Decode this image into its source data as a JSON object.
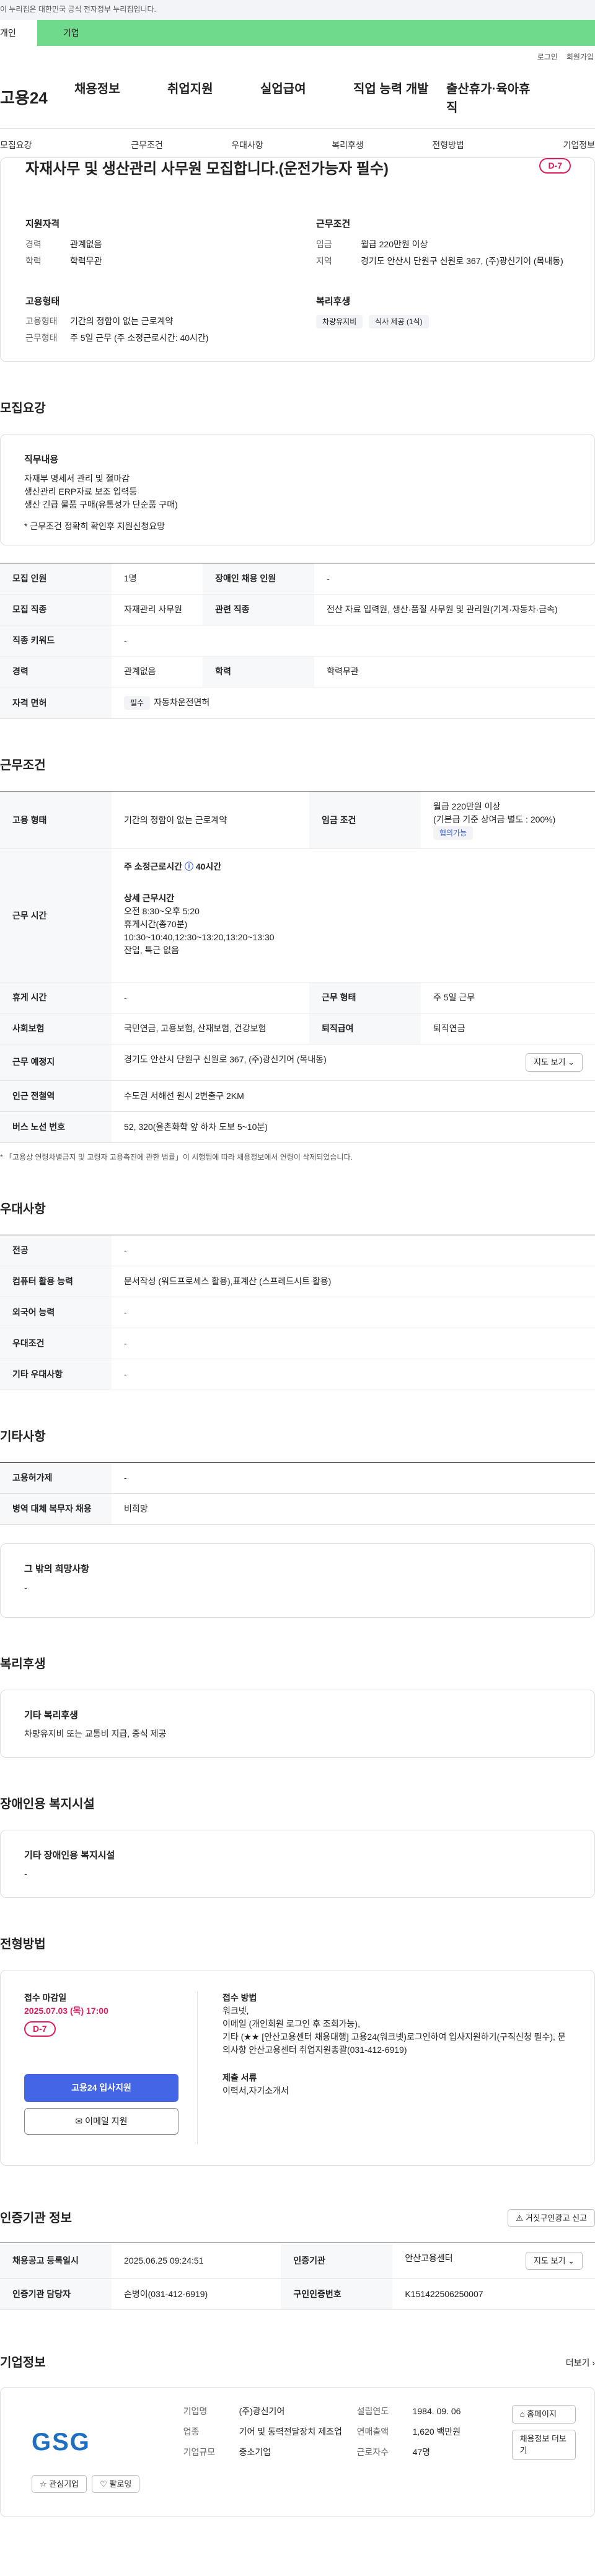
{
  "gov_banner": "이 누리집은 대한민국 공식 전자정부 누리집입니다.",
  "top_tabs": {
    "a": "개인",
    "b": "기업"
  },
  "util": {
    "login": "로그인",
    "join": "회원가입"
  },
  "gnb": {
    "logo": "고용24",
    "items": [
      "채용정보",
      "취업지원",
      "실업급여",
      "직업 능력 개발",
      "출산휴가·육아휴직"
    ]
  },
  "anchors": [
    "모집요강",
    "근무조건",
    "우대사항",
    "복리후생",
    "전형방법",
    "기업정보"
  ],
  "summary": {
    "title": "자재사무 및 생산관리 사무원 모집합니다.(운전가능자 필수)",
    "dday": "D-7",
    "groups": {
      "qual": {
        "title": "지원자격",
        "rows": [
          [
            "경력",
            "관계없음"
          ],
          [
            "학력",
            "학력무관"
          ]
        ]
      },
      "cond": {
        "title": "근무조건",
        "rows": [
          [
            "임금",
            "월급 220만원 이상"
          ],
          [
            "지역",
            "경기도 안산시 단원구 신원로 367, (주)광신기어 (목내동)"
          ]
        ]
      },
      "type": {
        "title": "고용형태",
        "rows": [
          [
            "고용형태",
            "기간의 정함이 없는 근로계약"
          ],
          [
            "근무형태",
            "주 5일 근무 (주 소정근로시간: 40시간)"
          ]
        ]
      },
      "welfare": {
        "title": "복리후생",
        "chips": [
          "차량유지비",
          "식사 제공 (1식)"
        ]
      }
    }
  },
  "recruit": {
    "title": "모집요강",
    "job_box_title": "직무내용",
    "job_lines": [
      "자재부 명세서 관리 및 절마감",
      "생산관리 ERP자료 보조 입력등",
      "생산 긴급 물품 구매(유통성가 단순품 구매)",
      "",
      "* 근무조건 정확히 확인후 지원신청요망"
    ],
    "rows": [
      {
        "k1": "모집 인원",
        "v1": "1명",
        "k2": "장애인 채용 인원",
        "v2": "-"
      },
      {
        "k1": "모집 직종",
        "v1": "자재관리 사무원",
        "k2": "관련 직종",
        "v2": "전산 자료 입력원, 생산·품질 사무원 및 관리원(기계·자동차·금속)"
      },
      {
        "k1": "직종 키워드",
        "v1": "-"
      },
      {
        "k1": "경력",
        "v1": "관계없음",
        "k2": "학력",
        "v2": "학력무관"
      },
      {
        "k1": "자격 면허",
        "badge": "필수",
        "v1": "자동차운전면허"
      }
    ]
  },
  "conditions": {
    "title": "근무조건",
    "type_k": "고용 형태",
    "type_v": "기간의 정함이 없는 근로계약",
    "wage_k": "임금 조건",
    "wage_lines": [
      "월급 220만원 이상",
      "(기본급 기준 상여금 별도 : 200%)"
    ],
    "wage_badge": "협의가능",
    "hours_k": "근무 시간",
    "hours_head": "주 소정근로시간",
    "hours_val": "40시간",
    "hours_lines": [
      "상세 근무시간",
      "오전 8:30~오후 5:20",
      "휴게시간(총70분)",
      "10:30~10:40,12:30~13:20,13:20~13:30",
      "잔업, 특근 없음"
    ],
    "rest_k": "휴게 시간",
    "rest_v": "-",
    "form_k": "근무 형태",
    "form_v": "주 5일 근무",
    "ins_k": "사회보험",
    "ins_v": "국민연금, 고용보험, 산재보험, 건강보험",
    "ret_k": "퇴직급여",
    "ret_v": "퇴직연금",
    "place_k": "근무 예정지",
    "place_v": "경기도 안산시 단원구 신원로 367, (주)광신기어 (목내동)",
    "map_btn": "지도 보기",
    "sub_k": "인근 전철역",
    "sub_v": "수도권 서해선 원시 2번출구 2KM",
    "bus_k": "버스 노선 번호",
    "bus_v": "52, 320(율촌화학 앞 하차 도보 5~10분)",
    "note": "* 「고용상 연령차별금지 및 고령자 고용촉진에 관한 법률」이 시행됨에 따라 채용정보에서 연령이 삭제되었습니다."
  },
  "pref": {
    "title": "우대사항",
    "rows": [
      [
        "전공",
        "-"
      ],
      [
        "컴퓨터 활용 능력",
        "문서작성 (워드프로세스 활용),표계산 (스프레드시트 활용)"
      ],
      [
        "외국어 능력",
        "-"
      ],
      [
        "우대조건",
        "-"
      ],
      [
        "기타 우대사항",
        "-"
      ]
    ]
  },
  "etc": {
    "title": "기타사항",
    "rows": [
      [
        "고용허가제",
        "-"
      ],
      [
        "병역 대체 복무자 채용",
        "비희망"
      ]
    ],
    "box_title": "그 밖의 희망사항",
    "box_val": "-"
  },
  "welfare": {
    "title": "복리후생",
    "box_title": "기타 복리후생",
    "box_val": "차량유지비 또는 교통비 지급, 중식 제공"
  },
  "disabled": {
    "title": "장애인용 복지시설",
    "box_title": "기타 장애인용 복지시설",
    "box_val": "-"
  },
  "apply": {
    "title": "전형방법",
    "deadline_k": "접수 마감일",
    "deadline_v": "2025.07.03 (목) 17:00",
    "dday": "D-7",
    "method_k": "접수 방법",
    "method_lines": [
      "워크넷,",
      "이메일 (개인회원 로그인 후 조회가능),",
      "기타 (★★ [안산고용센터 채용대행] 고용24(워크넷)로그인하여 입사지원하기(구직신청 필수), 문의사항 안산고용센터 취업지원총괄(031-412-6919)"
    ],
    "docs_k": "제출 서류",
    "docs_v": "이력서,자기소개서",
    "btn_primary": "고용24 입사지원",
    "btn_email": "이메일 지원"
  },
  "agency": {
    "title": "인증기관 정보",
    "report_btn": "거짓구인광고 신고",
    "rows": [
      {
        "k1": "채용공고 등록일시",
        "v1": "2025.06.25 09:24:51",
        "k2": "인증기관",
        "v2": "안산고용센터",
        "btn": "지도 보기"
      },
      {
        "k1": "인증기관 담당자",
        "v1": "손병이(031-412-6919)",
        "k2": "구인인증번호",
        "v2": "K151422506250007"
      }
    ]
  },
  "company": {
    "title": "기업정보",
    "more": "더보기",
    "logo": "GSG",
    "fav_btn": "관심기업",
    "follow_btn": "팔로잉",
    "cells": [
      [
        "기업명",
        "(주)광신기어"
      ],
      [
        "설립연도",
        "1984. 09. 06"
      ],
      [
        "업종",
        "기어 및 동력전달장치 제조업"
      ],
      [
        "연매출액",
        "1,620 백만원"
      ],
      [
        "기업규모",
        "중소기업"
      ],
      [
        "근로자수",
        "47명"
      ]
    ],
    "homepage_btn": "홈페이지",
    "info_btn": "채용정보 더보기"
  }
}
